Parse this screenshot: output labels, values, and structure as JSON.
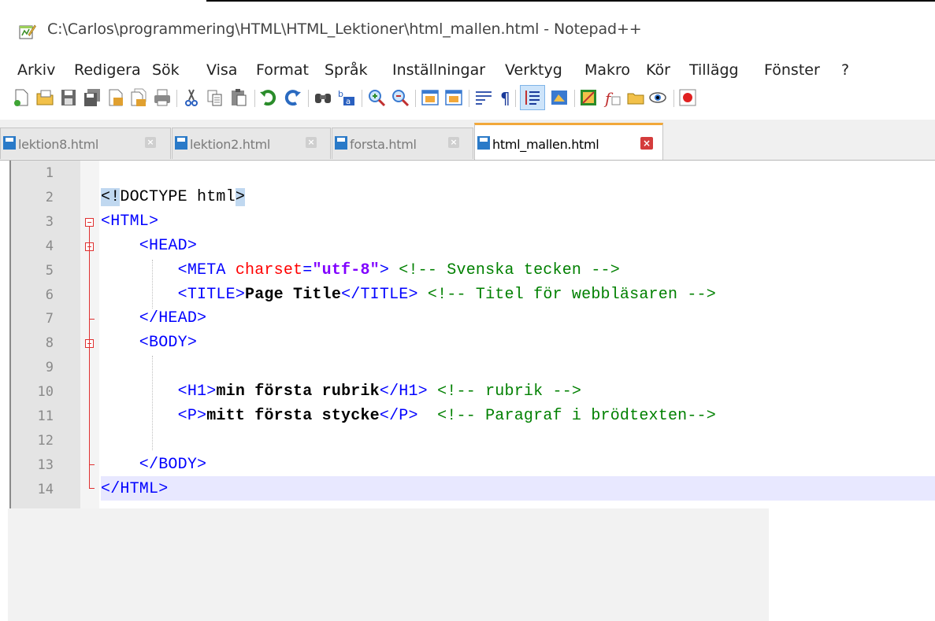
{
  "window": {
    "title": "C:\\Carlos\\programmering\\HTML\\HTML_Lektioner\\html_mallen.html - Notepad++",
    "app_icon": "notepad-plus-plus-icon"
  },
  "menu": [
    "Arkiv",
    "Redigera",
    "Sök",
    "Visa",
    "Format",
    "Språk",
    "Inställningar",
    "Verktyg",
    "Makro",
    "Kör",
    "Tillägg",
    "Fönster",
    "?"
  ],
  "toolbar_icons": [
    "new-file-icon",
    "open-file-icon",
    "save-icon",
    "save-all-icon",
    "close-icon",
    "close-all-icon",
    "print-icon",
    "cut-icon",
    "copy-icon",
    "paste-icon",
    "undo-icon",
    "redo-icon",
    "find-icon",
    "replace-icon",
    "zoom-in-icon",
    "zoom-out-icon",
    "sync-vertical-icon",
    "sync-horizontal-icon",
    "word-wrap-icon",
    "show-all-characters-icon",
    "indent-guide-icon",
    "user-language-icon",
    "document-map-icon",
    "function-list-icon",
    "folder-as-workspace-icon",
    "monitoring-icon",
    "record-macro-icon"
  ],
  "tabs": [
    {
      "label": "lektion8.html",
      "active": false
    },
    {
      "label": "lektion2.html",
      "active": false
    },
    {
      "label": "forsta.html",
      "active": false
    },
    {
      "label": "html_mallen.html",
      "active": true
    }
  ],
  "colors": {
    "tag": "#0000ff",
    "attribute": "#ff0000",
    "attribute_value": "#8000ff",
    "comment": "#008000",
    "current_line": "#e8e8ff",
    "active_tab_accent": "#f2a83a"
  },
  "editor": {
    "line_numbers": [
      "1",
      "2",
      "3",
      "4",
      "5",
      "6",
      "7",
      "8",
      "9",
      "10",
      "11",
      "12",
      "13",
      "14"
    ],
    "current_line": 14,
    "lines": [
      [],
      [
        {
          "t": "<!",
          "c": "hl"
        },
        {
          "t": "DOCTYPE html",
          "c": "dt"
        },
        {
          "t": ">",
          "c": "hl"
        }
      ],
      [
        {
          "t": "<HTML>",
          "c": "tag"
        }
      ],
      [
        {
          "t": "    <HEAD>",
          "c": "tag"
        }
      ],
      [
        {
          "t": "        <META ",
          "c": "tag"
        },
        {
          "t": "charset",
          "c": "attr"
        },
        {
          "t": "=",
          "c": "tag"
        },
        {
          "t": "\"utf-8\"",
          "c": "val"
        },
        {
          "t": "> ",
          "c": "tag"
        },
        {
          "t": "<!-- Svenska tecken -->",
          "c": "cmt"
        }
      ],
      [
        {
          "t": "        <TITLE>",
          "c": "tag"
        },
        {
          "t": "Page Title",
          "c": "txt"
        },
        {
          "t": "</TITLE> ",
          "c": "tag"
        },
        {
          "t": "<!-- Titel för webbläsaren -->",
          "c": "cmt"
        }
      ],
      [
        {
          "t": "    </HEAD>",
          "c": "tag"
        }
      ],
      [
        {
          "t": "    <BODY>",
          "c": "tag"
        }
      ],
      [],
      [
        {
          "t": "        <H1>",
          "c": "tag"
        },
        {
          "t": "min första rubrik",
          "c": "txt"
        },
        {
          "t": "</H1> ",
          "c": "tag"
        },
        {
          "t": "<!-- rubrik -->",
          "c": "cmt"
        }
      ],
      [
        {
          "t": "        <P>",
          "c": "tag"
        },
        {
          "t": "mitt första stycke",
          "c": "txt"
        },
        {
          "t": "</P>  ",
          "c": "tag"
        },
        {
          "t": "<!-- Paragraf i brödtexten-->",
          "c": "cmt"
        }
      ],
      [],
      [
        {
          "t": "    </BODY>",
          "c": "tag"
        }
      ],
      [
        {
          "t": "</HTML>",
          "c": "tag"
        }
      ]
    ]
  }
}
